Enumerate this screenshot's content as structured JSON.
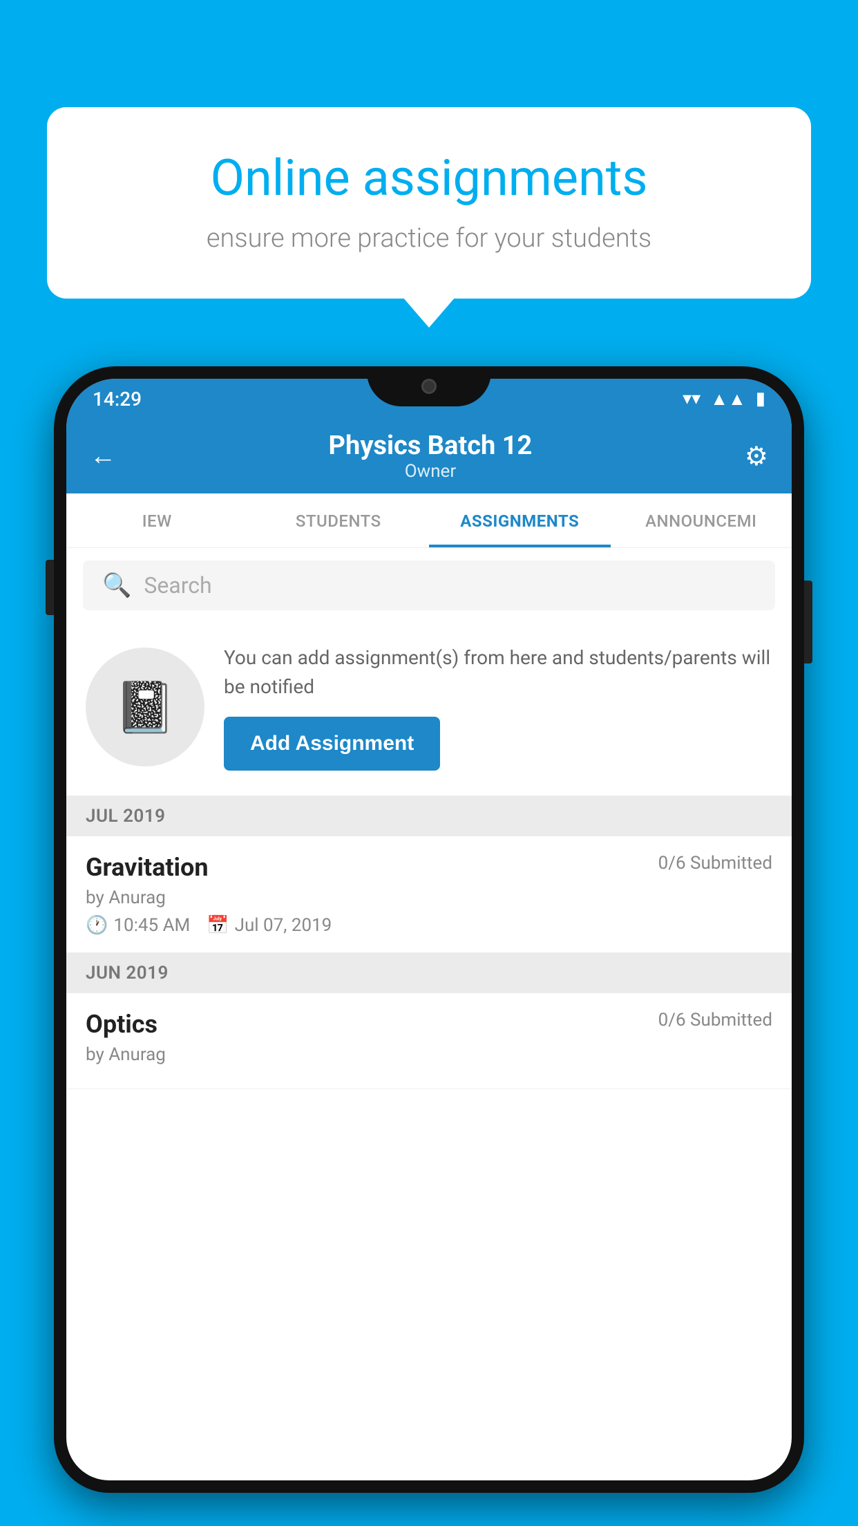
{
  "background": {
    "color": "#00AEEF"
  },
  "speech_bubble": {
    "title": "Online assignments",
    "subtitle": "ensure more practice for your students"
  },
  "phone": {
    "status_bar": {
      "time": "14:29",
      "icons": [
        "wifi",
        "signal",
        "battery"
      ]
    },
    "header": {
      "title": "Physics Batch 12",
      "subtitle": "Owner",
      "back_label": "←",
      "settings_label": "⚙"
    },
    "tabs": [
      {
        "label": "IEW",
        "active": false
      },
      {
        "label": "STUDENTS",
        "active": false
      },
      {
        "label": "ASSIGNMENTS",
        "active": true
      },
      {
        "label": "ANNOUNCEMI",
        "active": false
      }
    ],
    "search": {
      "placeholder": "Search"
    },
    "promo": {
      "text": "You can add assignment(s) from here and students/parents will be notified",
      "button_label": "Add Assignment"
    },
    "sections": [
      {
        "month": "JUL 2019",
        "assignments": [
          {
            "name": "Gravitation",
            "submitted": "0/6 Submitted",
            "by": "by Anurag",
            "time": "10:45 AM",
            "date": "Jul 07, 2019"
          }
        ]
      },
      {
        "month": "JUN 2019",
        "assignments": [
          {
            "name": "Optics",
            "submitted": "0/6 Submitted",
            "by": "by Anurag",
            "time": "",
            "date": ""
          }
        ]
      }
    ]
  }
}
